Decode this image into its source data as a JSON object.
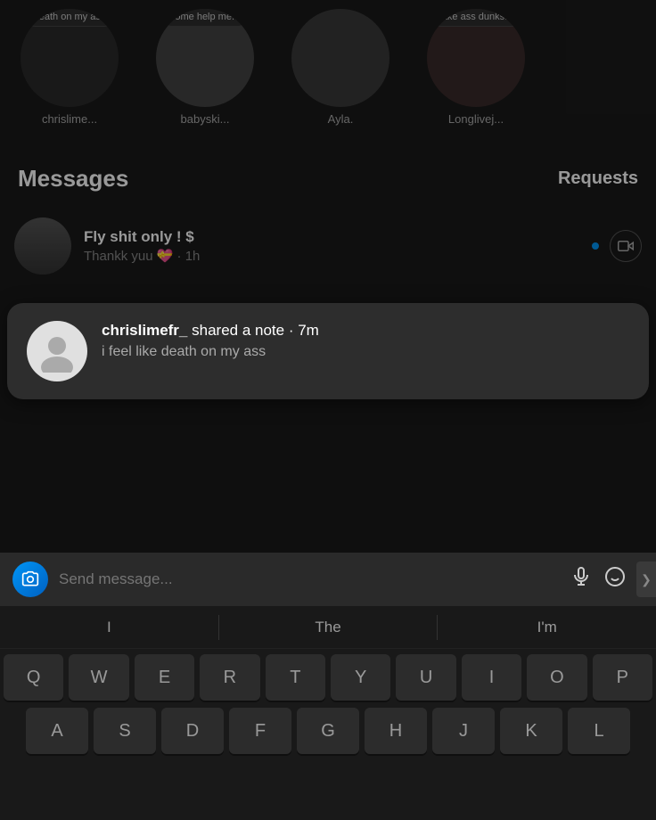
{
  "stories": [
    {
      "name": "chrislime...",
      "note": "death on\nmy ass",
      "color": "#2a2a2a"
    },
    {
      "name": "babyski...",
      "note": "come\nhelp me...",
      "color": "#3a3540"
    },
    {
      "name": "Ayla.",
      "note": "",
      "color": "#404040"
    },
    {
      "name": "Longlivej...",
      "note": "fake ass\ndunks...",
      "color": "#3a3030"
    }
  ],
  "header": {
    "messages_label": "Messages",
    "requests_label": "Requests"
  },
  "message_items": [
    {
      "sender": "Fly shit only ! $",
      "preview": "Thankk yuu 💝 · 1h",
      "unread": true
    }
  ],
  "popup": {
    "username": "chrislimefr_",
    "action": "shared a note",
    "time": "7m",
    "message": "i feel like death on my ass"
  },
  "input_bar": {
    "placeholder": "Send message..."
  },
  "suggestions": [
    "I",
    "The",
    "I'm"
  ],
  "keyboard_rows": [
    [
      "Q",
      "W",
      "E",
      "R",
      "T",
      "Y",
      "U",
      "I",
      "O",
      "P"
    ],
    [
      "A",
      "S",
      "D",
      "F",
      "G",
      "H",
      "J",
      "K",
      "L"
    ]
  ]
}
